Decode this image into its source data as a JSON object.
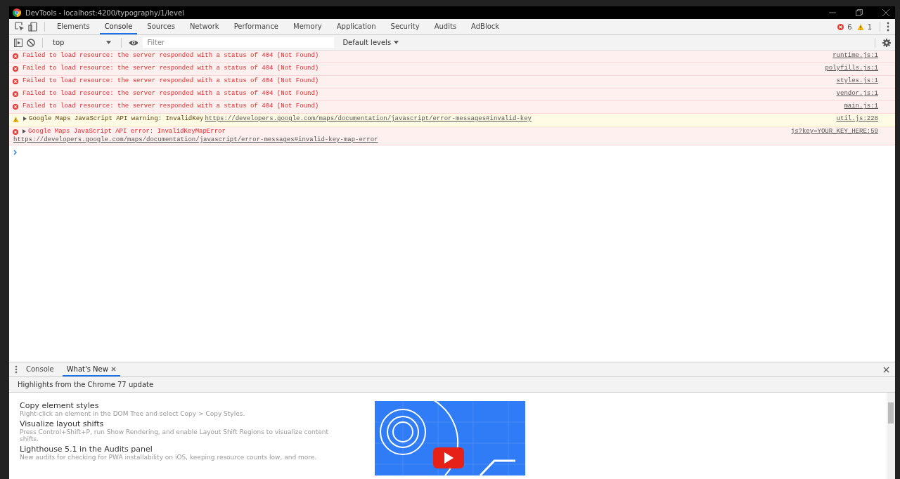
{
  "window": {
    "title": "DevTools - localhost:4200/typography/1/level"
  },
  "tabs": [
    {
      "label": "Elements",
      "selected": false
    },
    {
      "label": "Console",
      "selected": true
    },
    {
      "label": "Sources",
      "selected": false
    },
    {
      "label": "Network",
      "selected": false
    },
    {
      "label": "Performance",
      "selected": false
    },
    {
      "label": "Memory",
      "selected": false
    },
    {
      "label": "Application",
      "selected": false
    },
    {
      "label": "Security",
      "selected": false
    },
    {
      "label": "Audits",
      "selected": false
    },
    {
      "label": "AdBlock",
      "selected": false
    }
  ],
  "counts": {
    "errors": "6",
    "warnings": "1"
  },
  "toolbar": {
    "context": "top",
    "filter": {
      "placeholder": "Filter"
    },
    "levels": "Default levels"
  },
  "messages": [
    {
      "kind": "error",
      "expandable": false,
      "text": "Failed to load resource: the server responded with a status of 404 (Not Found)",
      "source": "runtime.js:1"
    },
    {
      "kind": "error",
      "expandable": false,
      "text": "Failed to load resource: the server responded with a status of 404 (Not Found)",
      "source": "polyfills.js:1"
    },
    {
      "kind": "error",
      "expandable": false,
      "text": "Failed to load resource: the server responded with a status of 404 (Not Found)",
      "source": "styles.js:1"
    },
    {
      "kind": "error",
      "expandable": false,
      "text": "Failed to load resource: the server responded with a status of 404 (Not Found)",
      "source": "vendor.js:1"
    },
    {
      "kind": "error",
      "expandable": false,
      "text": "Failed to load resource: the server responded with a status of 404 (Not Found)",
      "source": "main.js:1"
    },
    {
      "kind": "warning",
      "expandable": true,
      "text": "Google Maps JavaScript API warning: InvalidKey",
      "link": "https://developers.google.com/maps/documentation/javascript/error-messages#invalid-key",
      "link_wrapped": false,
      "source": "util.js:228"
    },
    {
      "kind": "error",
      "expandable": true,
      "text": "Google Maps JavaScript API error: InvalidKeyMapError",
      "link": "https://developers.google.com/maps/documentation/javascript/error-messages#invalid-key-map-error",
      "link_wrapped": true,
      "source": "js?key=YOUR_KEY_HERE:59"
    }
  ],
  "drawer": {
    "tabs": [
      {
        "label": "Console",
        "selected": false,
        "closable": false
      },
      {
        "label": "What's New",
        "selected": true,
        "closable": true
      }
    ],
    "header": "Highlights from the Chrome 77 update",
    "items": [
      {
        "title": "Copy element styles",
        "description": "Right-click an element in the DOM Tree and select Copy > Copy Styles."
      },
      {
        "title": "Visualize layout shifts",
        "description": "Press Control+Shift+P, run Show Rendering, and enable Layout Shift Regions to visualize content shifts."
      },
      {
        "title": "Lighthouse 5.1 in the Audits panel",
        "description": "New audits for checking for PWA installability on iOS, keeping resource counts low, and more."
      }
    ]
  }
}
